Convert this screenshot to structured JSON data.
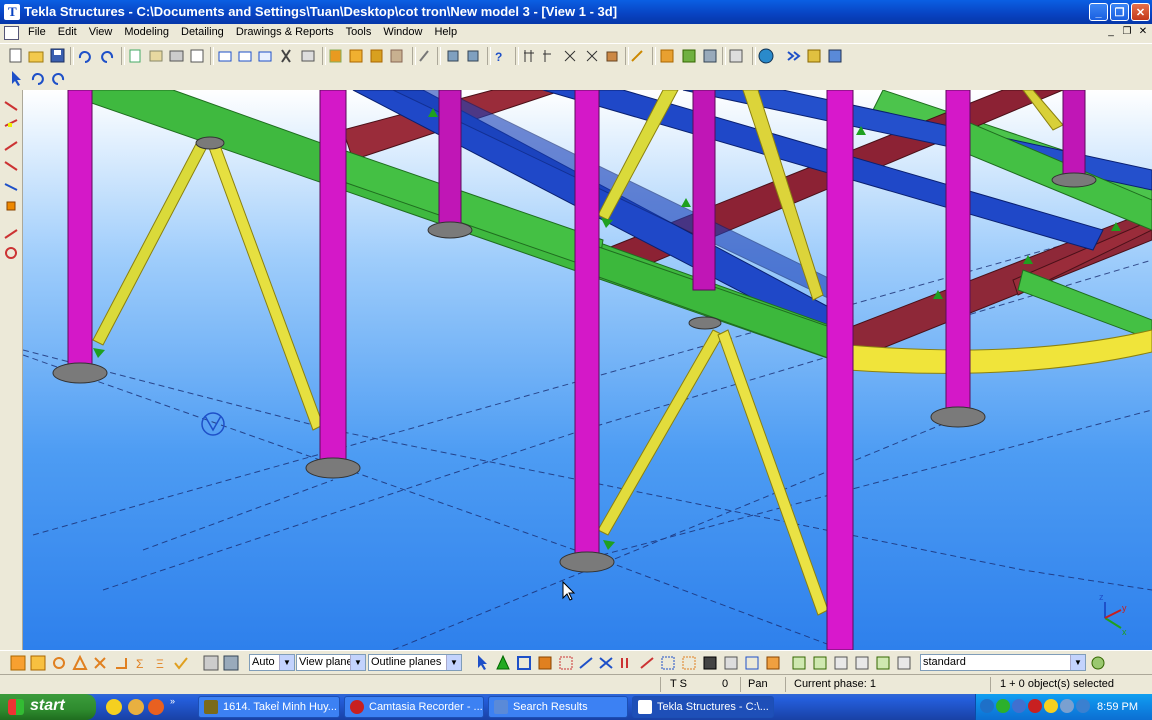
{
  "window": {
    "title": "Tekla Structures - C:\\Documents and Settings\\Tuan\\Desktop\\cot tron\\New model 3 - [View 1 - 3d]",
    "caption_buttons": [
      "_",
      "❐",
      "✕"
    ]
  },
  "menu": {
    "items": [
      "File",
      "Edit",
      "View",
      "Modeling",
      "Detailing",
      "Drawings & Reports",
      "Tools",
      "Window",
      "Help"
    ],
    "mdi_controls": [
      "_",
      "❐",
      "✕"
    ]
  },
  "bottom_toolbar": {
    "select_auto": "Auto",
    "select_viewplane": "View plane",
    "select_outline": "Outline planes",
    "select_standard": "standard"
  },
  "statusbar": {
    "ts": "T S",
    "zero": "0",
    "pan": "Pan",
    "phase": "Current phase: 1",
    "selected": "1 + 0 object(s) selected"
  },
  "taskbar": {
    "start_label": "start",
    "tasks": [
      {
        "label": "1614. Takeỉ Minh Huy...",
        "icon_color": "#7a6a1a"
      },
      {
        "label": "Camtasia Recorder - ...",
        "icon_color": "#c82020"
      },
      {
        "label": "Search Results",
        "icon_color": "#5a8ad8"
      },
      {
        "label": "Tekla Structures - C:\\...",
        "icon_color": "#ffffff"
      }
    ],
    "clock": "8:59 PM"
  },
  "icons": {
    "start": "windows-flag-icon",
    "axis": "xyz-axis-icon",
    "cursor": "mouse-pointer-icon"
  }
}
